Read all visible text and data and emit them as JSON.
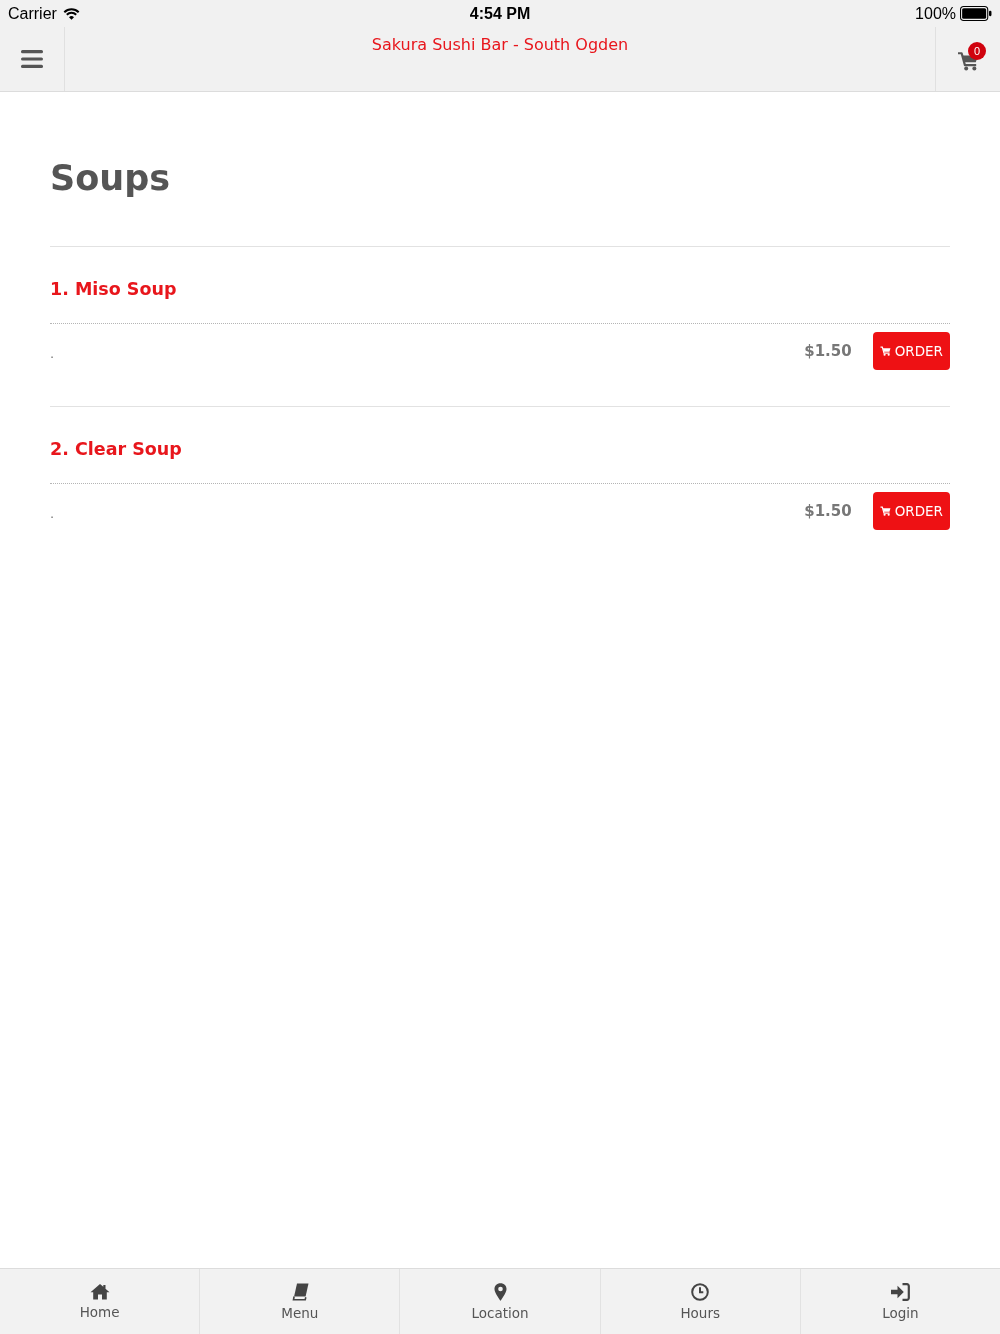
{
  "status_bar": {
    "carrier": "Carrier",
    "time": "4:54 PM",
    "battery_percent": "100%"
  },
  "header": {
    "title": "Sakura Sushi Bar - South Ogden",
    "cart_count": "0"
  },
  "section": {
    "title": "Soups"
  },
  "items": [
    {
      "name": "1. Miso Soup",
      "description": ".",
      "price": "$1.50",
      "button": "ORDER"
    },
    {
      "name": "2. Clear Soup",
      "description": ".",
      "price": "$1.50",
      "button": "ORDER"
    }
  ],
  "tab_bar": [
    {
      "label": "Home"
    },
    {
      "label": "Menu"
    },
    {
      "label": "Location"
    },
    {
      "label": "Hours"
    },
    {
      "label": "Login"
    }
  ]
}
